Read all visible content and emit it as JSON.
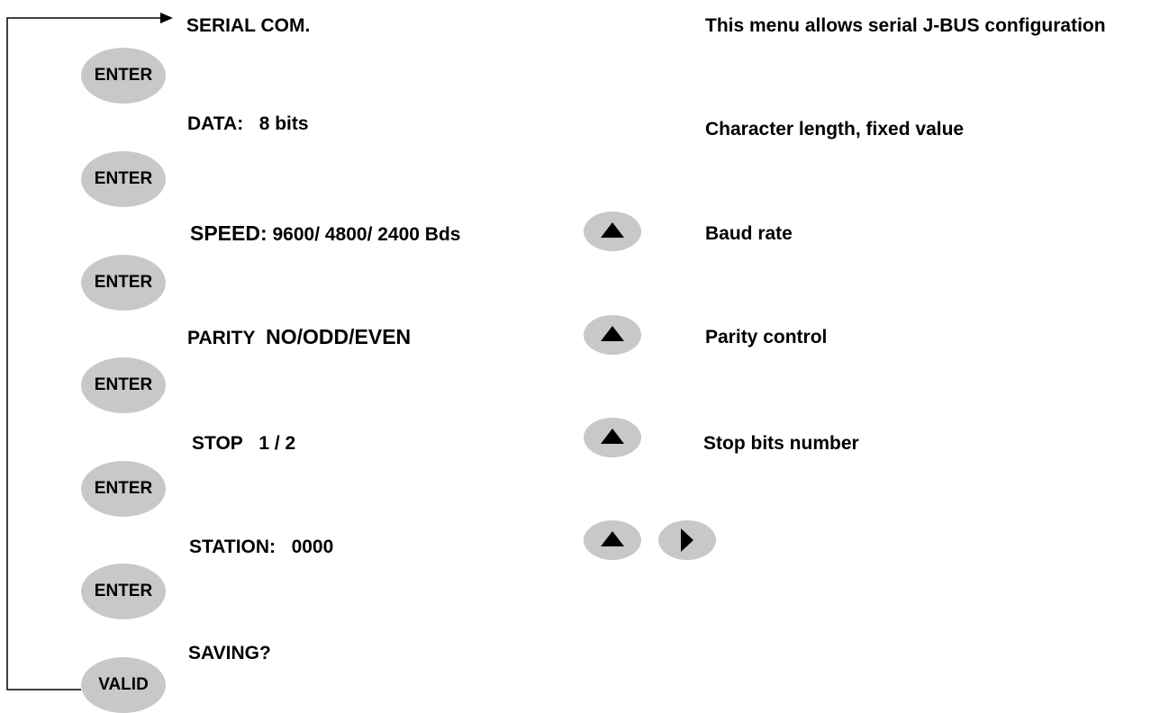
{
  "menu": {
    "title": "SERIAL COM.",
    "description": "This menu allows serial J-BUS configuration",
    "steps": [
      {
        "label": "DATA:",
        "value": "8 bits",
        "note": "Character length, fixed value"
      },
      {
        "label": "SPEED:",
        "value": "9600/ 4800/ 2400 Bds",
        "note": "Baud rate"
      },
      {
        "label": "PARITY",
        "value": "NO/ODD/EVEN",
        "note": "Parity control"
      },
      {
        "label": "STOP",
        "value": "1 / 2",
        "note": "Stop bits number"
      },
      {
        "label": "STATION:",
        "value": "0000"
      },
      {
        "label": "SAVING?"
      }
    ]
  },
  "buttons": {
    "enter": "ENTER",
    "valid": "VALID"
  },
  "icons": {
    "up": "triangle-up-icon",
    "right": "triangle-right-icon"
  },
  "colors": {
    "button_fill": "#c8c8c8"
  }
}
